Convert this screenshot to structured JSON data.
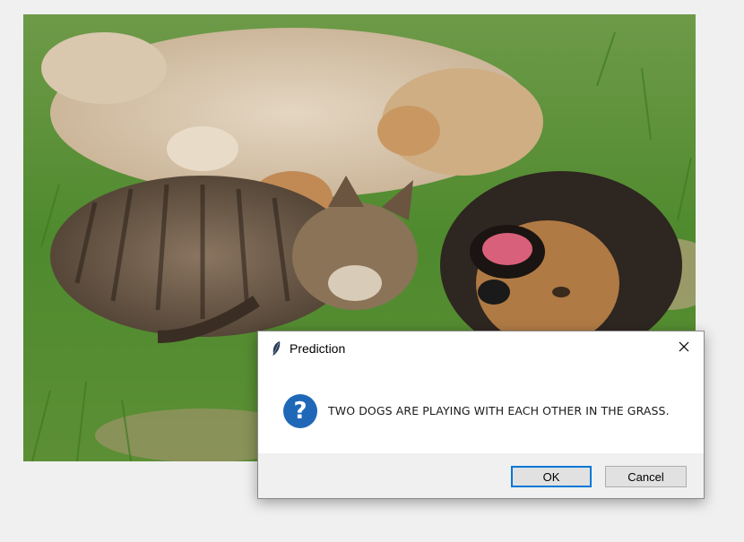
{
  "dialog": {
    "title": "Prediction",
    "message": "TWO DOGS ARE PLAYING WITH EACH OTHER IN THE GRASS.",
    "icon": "question-icon",
    "ok_label": "OK",
    "cancel_label": "Cancel",
    "close_glyph": "✕",
    "question_glyph": "?"
  },
  "colors": {
    "question_icon": "#1f68b8",
    "default_button_border": "#0078d7",
    "footer": "#f0f0f0"
  }
}
